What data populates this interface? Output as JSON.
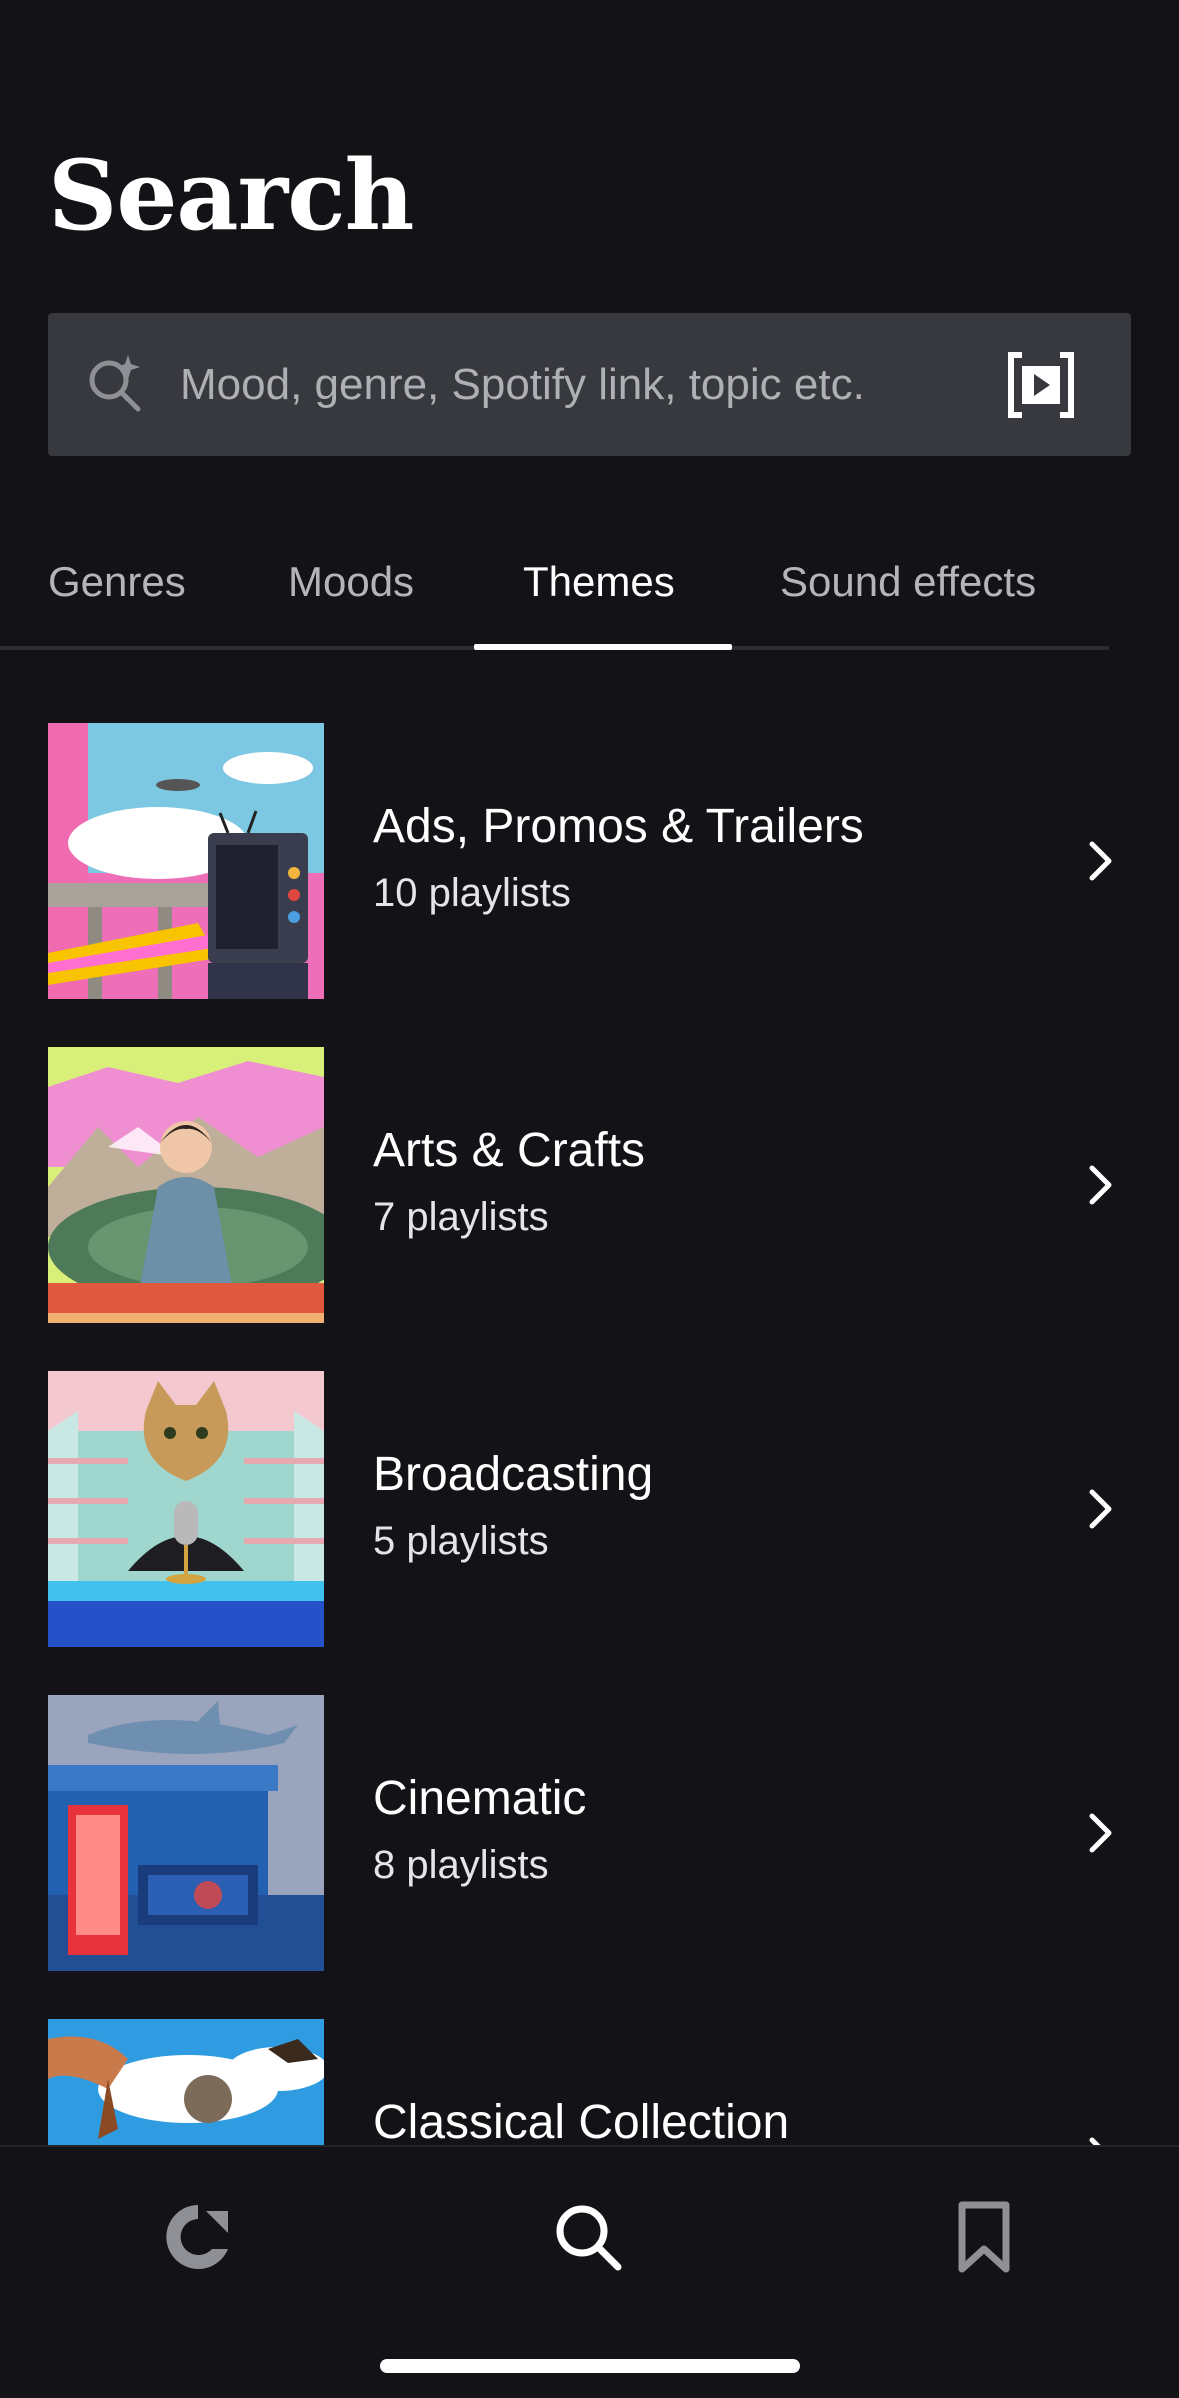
{
  "header": {
    "title": "Search"
  },
  "search": {
    "placeholder": "Mood, genre, Spotify link, topic etc.",
    "icon": "sparkle-search-icon",
    "action_icon": "media-link-icon"
  },
  "tabs": [
    {
      "label": "Genres",
      "active": false
    },
    {
      "label": "Moods",
      "active": false
    },
    {
      "label": "Themes",
      "active": true
    },
    {
      "label": "Sound effects",
      "active": false
    }
  ],
  "themes": [
    {
      "title": "Ads, Promos & Trailers",
      "subtitle": "10 playlists",
      "artwork": "retro-tv-collage"
    },
    {
      "title": "Arts & Crafts",
      "subtitle": "7 playlists",
      "artwork": "painted-portrait-collage"
    },
    {
      "title": "Broadcasting",
      "subtitle": "5 playlists",
      "artwork": "cat-microphone-collage"
    },
    {
      "title": "Cinematic",
      "subtitle": "8 playlists",
      "artwork": "shark-hollywood-collage"
    },
    {
      "title": "Classical Collection",
      "subtitle": "",
      "artwork": "violin-sky-collage"
    }
  ],
  "bottom_nav": [
    {
      "id": "home",
      "icon": "epidemic-logo-icon",
      "active": false
    },
    {
      "id": "search",
      "icon": "search-icon",
      "active": true
    },
    {
      "id": "saved",
      "icon": "bookmark-icon",
      "active": false
    }
  ],
  "colors": {
    "background": "#131317",
    "search_bar": "#38393e",
    "text_primary": "#ffffff",
    "text_secondary": "#b3b5ba"
  }
}
